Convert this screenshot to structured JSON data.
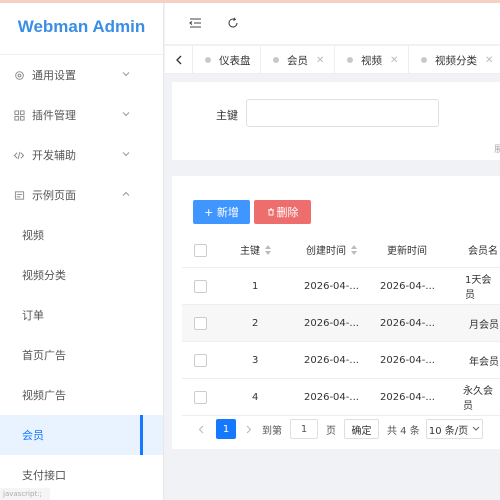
{
  "app": {
    "title": "Webman Admin"
  },
  "sidebar": {
    "groups": [
      {
        "label": "通用设置",
        "icon": "gear-icon"
      },
      {
        "label": "插件管理",
        "icon": "plugin-icon"
      },
      {
        "label": "开发辅助",
        "icon": "code-icon"
      },
      {
        "label": "示例页面",
        "icon": "page-icon"
      }
    ],
    "items": [
      {
        "label": "视频"
      },
      {
        "label": "视频分类"
      },
      {
        "label": "订单"
      },
      {
        "label": "首页广告"
      },
      {
        "label": "视频广告"
      },
      {
        "label": "会员",
        "active": true
      },
      {
        "label": "支付接口"
      }
    ],
    "corner_text": "javascript:;"
  },
  "tabs": [
    {
      "label": "仪表盘",
      "closable": false
    },
    {
      "label": "会员",
      "closable": true
    },
    {
      "label": "视频",
      "closable": true
    },
    {
      "label": "视频分类",
      "closable": true
    }
  ],
  "search": {
    "label": "主键",
    "value": "",
    "cut_text": "展"
  },
  "toolbar": {
    "add_label": "+ 新增",
    "delete_label": "删除"
  },
  "table": {
    "columns": [
      "主键",
      "创建时间",
      "更新时间",
      "会员名"
    ],
    "rows": [
      {
        "id": "1",
        "created": "2026-04-...",
        "updated": "2026-04-...",
        "name": "1天会员"
      },
      {
        "id": "2",
        "created": "2026-04-...",
        "updated": "2026-04-...",
        "name": "月会员"
      },
      {
        "id": "3",
        "created": "2026-04-...",
        "updated": "2026-04-...",
        "name": "年会员"
      },
      {
        "id": "4",
        "created": "2026-04-...",
        "updated": "2026-04-...",
        "name": "永久会员"
      }
    ]
  },
  "pagination": {
    "current_page": "1",
    "goto_label": "到第",
    "goto_value": "1",
    "page_unit": "页",
    "confirm_label": "确定",
    "total_label": "共 4 条",
    "page_size_label": "10 条/页"
  },
  "colors": {
    "accent": "#1677ff",
    "danger": "#ee6e6e",
    "logo": "#3a8ee6"
  }
}
